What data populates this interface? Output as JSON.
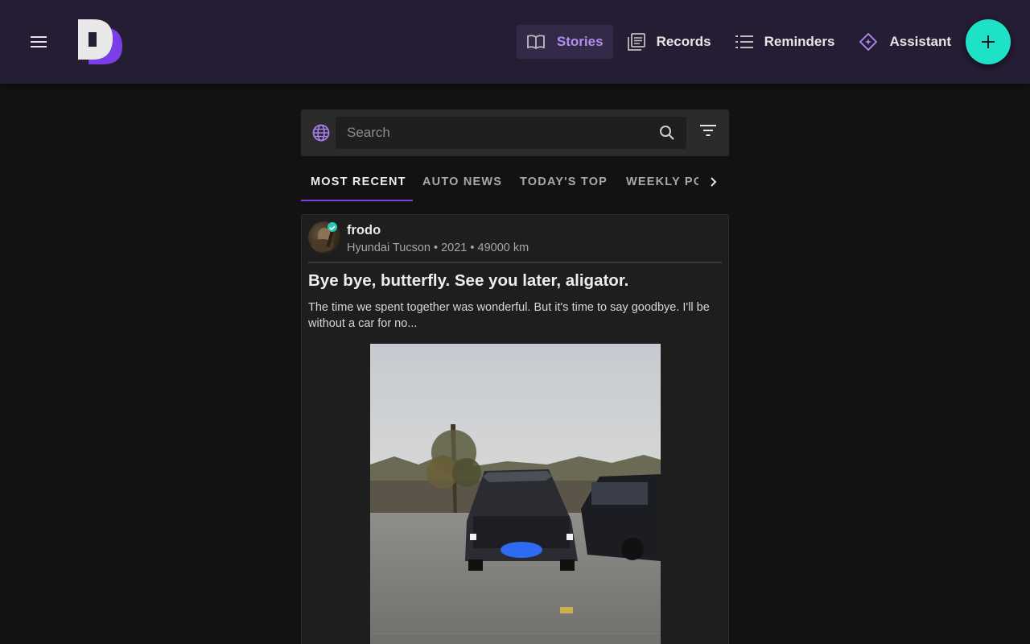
{
  "header": {
    "nav": [
      {
        "label": "Stories",
        "icon": "book-open-icon",
        "active": true
      },
      {
        "label": "Records",
        "icon": "records-icon",
        "active": false
      },
      {
        "label": "Reminders",
        "icon": "list-icon",
        "active": false
      },
      {
        "label": "Assistant",
        "icon": "sparkle-diamond-icon",
        "active": false
      }
    ],
    "fab_icon": "plus-icon"
  },
  "search": {
    "placeholder": "Search",
    "value": ""
  },
  "tabs": [
    {
      "label": "MOST RECENT",
      "active": true
    },
    {
      "label": "AUTO NEWS",
      "active": false
    },
    {
      "label": "TODAY'S TOP",
      "active": false
    },
    {
      "label": "WEEKLY POPULAR",
      "active": false
    }
  ],
  "post": {
    "author": "frodo",
    "meta": "Hyundai Tucson • 2021 • 49000 km",
    "title": "Bye bye, butterfly. See you later, aligator.",
    "excerpt": "The time we spent together was wonderful. But it's time to say goodbye. I'll be without a car for no..."
  },
  "colors": {
    "header_bg": "#241d33",
    "accent_purple": "#b28cf0",
    "tab_underline": "#7b3fe4",
    "fab": "#1de2c8",
    "page_bg": "#121212"
  }
}
